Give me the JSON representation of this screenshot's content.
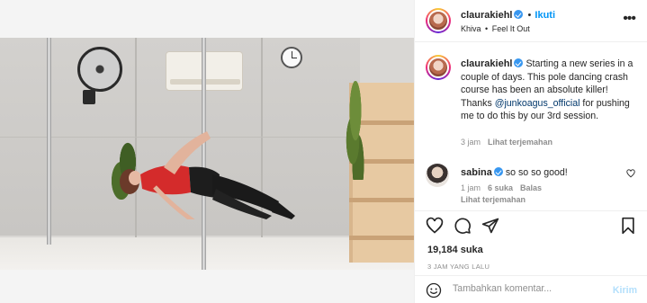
{
  "post": {
    "username": "claurakiehl",
    "follow_label": "Ikuti",
    "location": "Khiva",
    "audio": "Feel It Out",
    "more_icon": "more-horizontal-icon"
  },
  "caption": {
    "username": "claurakiehl",
    "text_before": "Starting a new series in a couple of days. This pole dancing crash course has been an absolute killer! Thanks ",
    "mention": "@junkoagus_official",
    "text_after": " for pushing me to do this by our 3rd session.",
    "time": "3 jam",
    "translate": "Lihat terjemahan"
  },
  "comment": {
    "username": "sabina",
    "text": "so so so good!",
    "time": "1 jam",
    "likes": "6 suka",
    "reply": "Balas",
    "translate": "Lihat terjemahan"
  },
  "actions": {
    "like_icon": "heart-icon",
    "comment_icon": "comment-icon",
    "share_icon": "share-icon",
    "save_icon": "bookmark-icon"
  },
  "likes": "19,184 suka",
  "posted_ago": "3 JAM YANG LALU",
  "compose": {
    "placeholder": "Tambahkan komentar...",
    "post_label": "Kirim"
  },
  "colors": {
    "link_blue": "#0095f6",
    "verified": "#3897f0",
    "mention": "#00376b",
    "muted": "#8e8e8e"
  }
}
